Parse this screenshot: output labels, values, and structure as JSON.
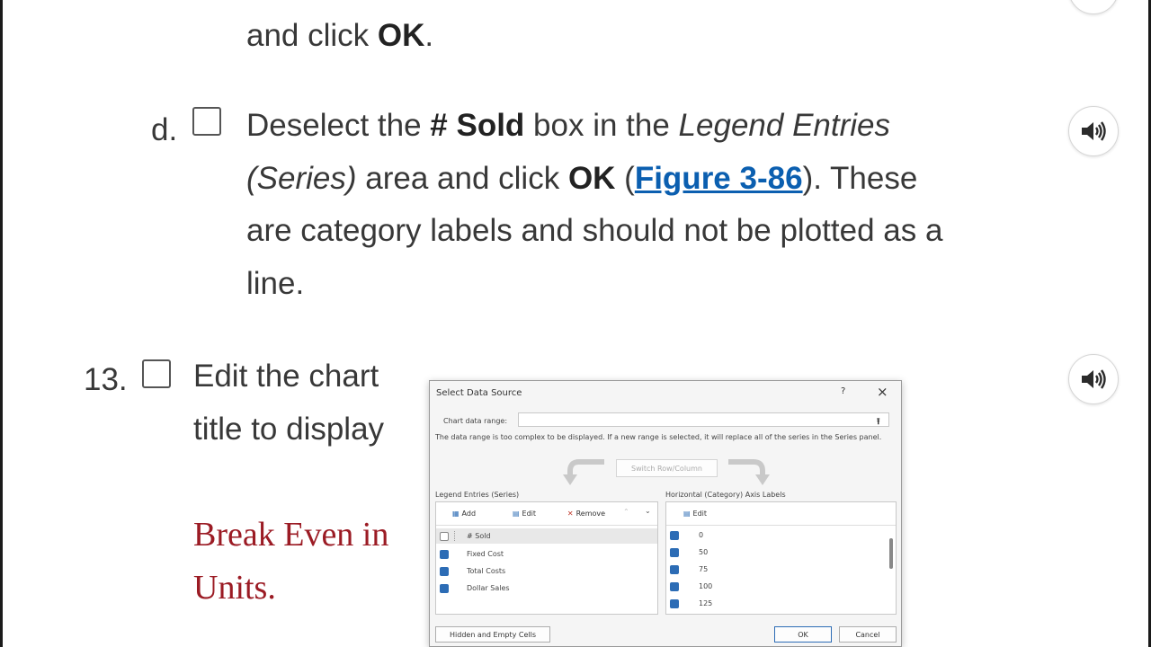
{
  "step_c_tail": {
    "prefix": "and click ",
    "ok": "OK",
    "suffix": "."
  },
  "step_d": {
    "marker": "d.",
    "t1": "Deselect the ",
    "b1": "# Sold",
    "t2": " box in the ",
    "i1": "Legend Entries (Series)",
    "t3": " area and click ",
    "b2": "OK",
    "t4": " (",
    "link": "Figure 3-86",
    "t5": "). These are category labels and should not be plotted as a line."
  },
  "step_13": {
    "marker": "13.",
    "text": "Edit the chart title to display",
    "highlight": "Break Even in Units."
  },
  "icons": {
    "audio": "speaker-icon"
  },
  "colors": {
    "link": "#0b5fb0",
    "highlight": "#9b1b24",
    "checkbox_blue": "#2c6cb5"
  },
  "dialog": {
    "title": "Select Data Source",
    "help": "?",
    "close": "×",
    "range_label": "Chart data range:",
    "note": "The data range is too complex to be displayed. If a new range is selected, it will replace all of the series in the Series panel.",
    "switch_label": "Switch Row/Column",
    "legend_label": "Legend Entries (Series)",
    "axis_label": "Horizontal (Category) Axis Labels",
    "add": "Add",
    "edit": "Edit",
    "remove": "Remove",
    "axis_edit": "Edit",
    "series": [
      {
        "name": "# Sold",
        "checked": false
      },
      {
        "name": "Fixed Cost",
        "checked": true
      },
      {
        "name": "Total Costs",
        "checked": true
      },
      {
        "name": "Dollar Sales",
        "checked": true
      }
    ],
    "categories": [
      "0",
      "50",
      "75",
      "100",
      "125"
    ],
    "hidden_btn": "Hidden and Empty Cells",
    "ok": "OK",
    "cancel": "Cancel"
  }
}
